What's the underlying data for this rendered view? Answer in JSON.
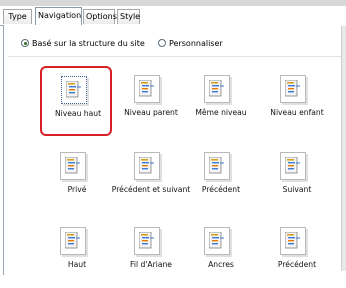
{
  "tabs": [
    {
      "label": "Type"
    },
    {
      "label": "Navigation"
    },
    {
      "label": "Options"
    },
    {
      "label": "Style"
    }
  ],
  "mode": {
    "option_site_structure": "Basé sur la structure du site",
    "option_custom": "Personnaliser",
    "selected": "site_structure"
  },
  "accent_color": "#d61f26",
  "nav_items": [
    {
      "label": "Niveau haut",
      "selected": true,
      "icon": "top-level-icon"
    },
    {
      "label": "Niveau parent",
      "selected": false,
      "icon": "parent-level-icon"
    },
    {
      "label": "Même niveau",
      "selected": false,
      "icon": "same-level-icon"
    },
    {
      "label": "Niveau enfant",
      "selected": false,
      "icon": "child-level-icon"
    },
    {
      "label": "Privé",
      "selected": false,
      "icon": "private-icon"
    },
    {
      "label": "Précédent et suivant",
      "selected": false,
      "icon": "prev-next-icon"
    },
    {
      "label": "Précédent",
      "selected": false,
      "icon": "previous-icon"
    },
    {
      "label": "Suivant",
      "selected": false,
      "icon": "next-icon"
    },
    {
      "label": "Haut",
      "selected": false,
      "icon": "up-icon"
    },
    {
      "label": "Fil d'Ariane",
      "selected": false,
      "icon": "breadcrumb-icon"
    },
    {
      "label": "Ancres",
      "selected": false,
      "icon": "anchors-icon"
    },
    {
      "label": "Précédent",
      "selected": false,
      "icon": "previous-alt-icon"
    }
  ]
}
